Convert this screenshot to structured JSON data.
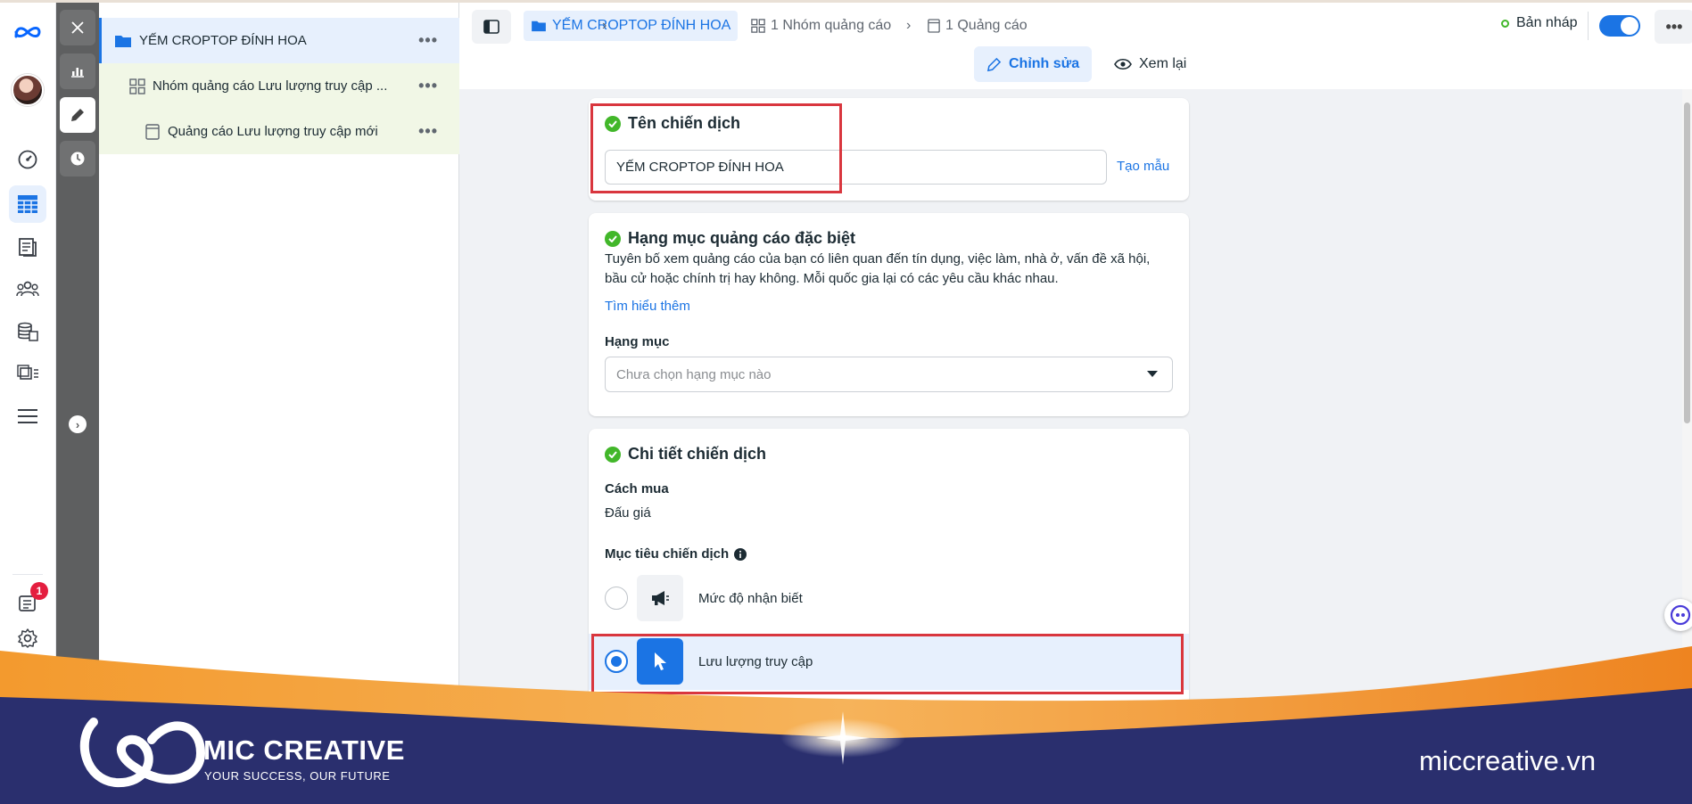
{
  "tree": {
    "campaign": "YẾM CROPTOP ĐÍNH HOA",
    "adset": "Nhóm quảng cáo Lưu lượng truy cập ...",
    "ad": "Quảng cáo Lưu lượng truy cập mới",
    "more": "•••"
  },
  "notifications": {
    "count": "1"
  },
  "header": {
    "crumb_campaign": "YẾM CROPTOP ĐÍNH HOA",
    "crumb_adsets": "1 Nhóm quảng cáo",
    "crumb_ads": "1 Quảng cáo",
    "status": "Bản nháp",
    "mode_edit": "Chỉnh sửa",
    "mode_review": "Xem lại"
  },
  "campaign_name": {
    "title": "Tên chiến dịch",
    "value": "YẾM CROPTOP ĐÍNH HOA",
    "template_link": "Tạo mẫu"
  },
  "special_category": {
    "title": "Hạng mục quảng cáo đặc biệt",
    "desc_line1": "Tuyên bố xem quảng cáo của bạn có liên quan đến tín dụng, việc làm, nhà ở, vấn đề xã hội,",
    "desc_line2": "bầu cử hoặc chính trị hay không. Mỗi quốc gia lại có các yêu cầu khác nhau.",
    "learn_more": "Tìm hiểu thêm",
    "category_label": "Hạng mục",
    "category_placeholder": "Chưa chọn hạng mục nào"
  },
  "details": {
    "title": "Chi tiết chiến dịch",
    "buy_label": "Cách mua",
    "buy_value": "Đấu giá",
    "objective_label": "Mục tiêu chiến dịch",
    "options": [
      {
        "label": "Mức độ nhận biết",
        "selected": false
      },
      {
        "label": "Lưu lượng truy cập",
        "selected": true
      }
    ]
  },
  "footer": {
    "brand": "MIC CREATIVE",
    "tagline": "YOUR SUCCESS, OUR FUTURE",
    "website": "miccreative.vn"
  },
  "colors": {
    "accent": "#1b74e4",
    "success": "#42b72a",
    "highlight": "#d9363e",
    "banner_navy": "#2a2f6e",
    "banner_orange": "#f08a24"
  }
}
